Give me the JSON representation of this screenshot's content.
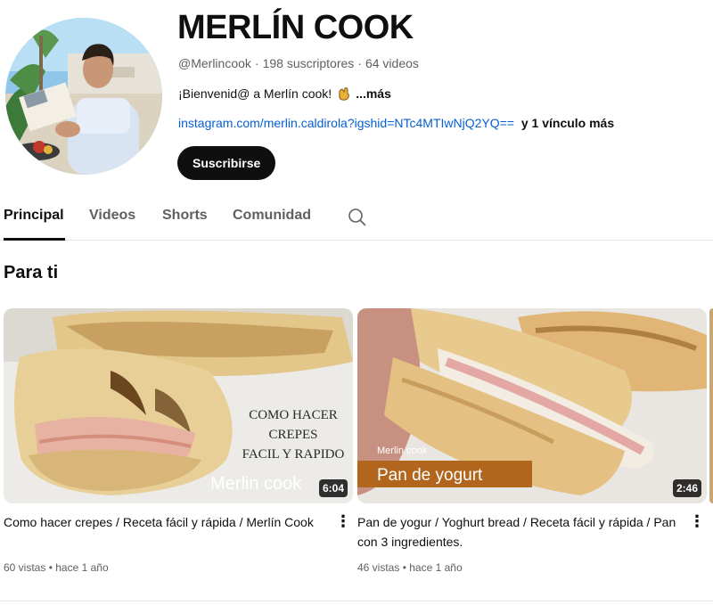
{
  "channel": {
    "name": "MERLÍN COOK",
    "handle": "@Merlincook",
    "subscribers": "198 suscriptores",
    "videos_count": "64 videos",
    "description": "¡Bienvenid@ a Merlín cook!",
    "description_more": "...más",
    "link": "instagram.com/merlin.caldirola?igshid=NTc4MTIwNjQ2YQ==",
    "more_links": "y 1 vínculo más",
    "subscribe_label": "Suscribirse"
  },
  "tabs": [
    {
      "label": "Principal",
      "active": true
    },
    {
      "label": "Videos",
      "active": false
    },
    {
      "label": "Shorts",
      "active": false
    },
    {
      "label": "Comunidad",
      "active": false
    }
  ],
  "search_icon": "search-icon",
  "section": {
    "title": "Para ti"
  },
  "videos": [
    {
      "title": "Como hacer crepes / Receta fácil y rápida / Merlín Cook",
      "duration": "6:04",
      "views": "60 vistas",
      "age": "hace 1 año",
      "overlay_lines": [
        "COMO HACER",
        "CREPES",
        "FACIL Y RAPIDO"
      ],
      "watermark": "Merlin cook"
    },
    {
      "title": "Pan de yogur / Yoghurt bread / Receta fácil y rápida / Pan con 3 ingredientes.",
      "duration": "2:46",
      "views": "46 vistas",
      "age": "hace 1 año",
      "overlay_small": "Merlin cook",
      "overlay_banner": "Pan de yogurt"
    }
  ],
  "colors": {
    "link": "#065fd4",
    "button_bg": "#0f0f0f",
    "muted_text": "#606060"
  }
}
